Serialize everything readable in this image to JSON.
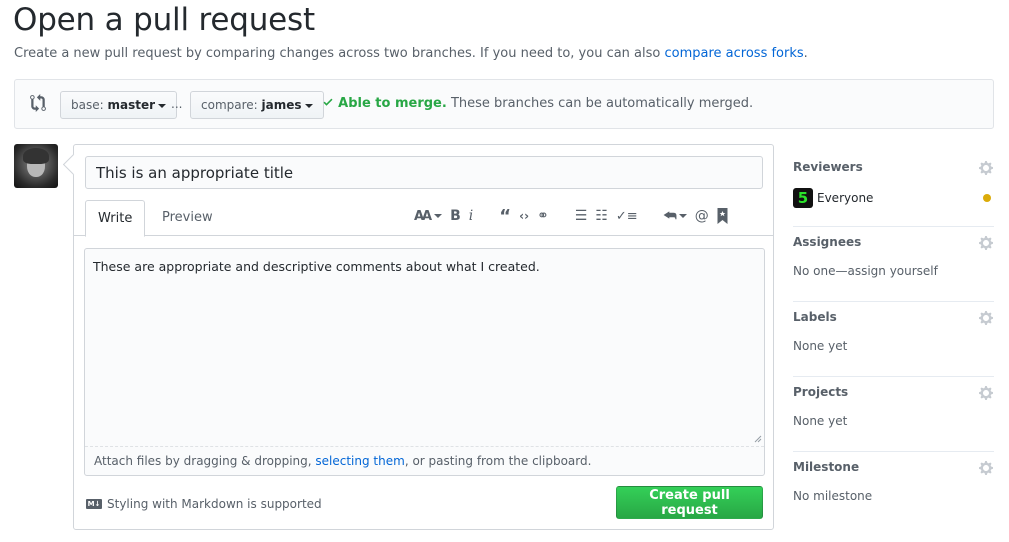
{
  "page": {
    "title": "Open a pull request",
    "subtitle": "Create a new pull request by comparing changes across two branches. If you need to, you can also ",
    "subtitle_link": "compare across forks",
    "subtitle_end": "."
  },
  "range": {
    "base_label": "base:",
    "base_value": "master",
    "dots": "...",
    "compare_label": "compare:",
    "compare_value": "james",
    "merge_status": "Able to merge.",
    "merge_message": " These branches can be automatically merged.",
    "status_color": "#28a745"
  },
  "form": {
    "title_value": "This is an appropriate title",
    "tabs": [
      {
        "label": "Write",
        "active": true
      },
      {
        "label": "Preview",
        "active": false
      }
    ],
    "toolbar": [
      {
        "icon": "text-size-icon",
        "glyph": "AA"
      },
      {
        "icon": "bold-icon",
        "glyph": "B"
      },
      {
        "icon": "italic-icon",
        "glyph": "i"
      },
      {
        "icon": "quote-icon",
        "glyph": "❝"
      },
      {
        "icon": "code-icon",
        "glyph": "<>"
      },
      {
        "icon": "link-icon",
        "glyph": "⚯"
      },
      {
        "icon": "unordered-list-icon",
        "glyph": "☰"
      },
      {
        "icon": "ordered-list-icon",
        "glyph": "≡"
      },
      {
        "icon": "task-list-icon",
        "glyph": "✓"
      },
      {
        "icon": "reply-icon",
        "glyph": "↶"
      },
      {
        "icon": "mention-icon",
        "glyph": "@"
      },
      {
        "icon": "saved-reply-icon",
        "glyph": "★"
      }
    ],
    "body_value": "These are appropriate and descriptive comments about what I created.",
    "attach_prefix": "Attach files by dragging & dropping, ",
    "attach_link": "selecting them",
    "attach_suffix": ", or pasting from the clipboard.",
    "markdown_note": "Styling with Markdown is supported",
    "markdown_icon_text": "M↓",
    "submit_label": "Create pull request"
  },
  "sidebar": {
    "reviewers": {
      "heading": "Reviewers",
      "name": "Everyone",
      "avatar_glyph": "5",
      "status_color": "#dbab09"
    },
    "assignees": {
      "heading": "Assignees",
      "value": "No one—assign yourself"
    },
    "labels": {
      "heading": "Labels",
      "value": "None yet"
    },
    "projects": {
      "heading": "Projects",
      "value": "None yet"
    },
    "milestone": {
      "heading": "Milestone",
      "value": "No milestone"
    }
  }
}
